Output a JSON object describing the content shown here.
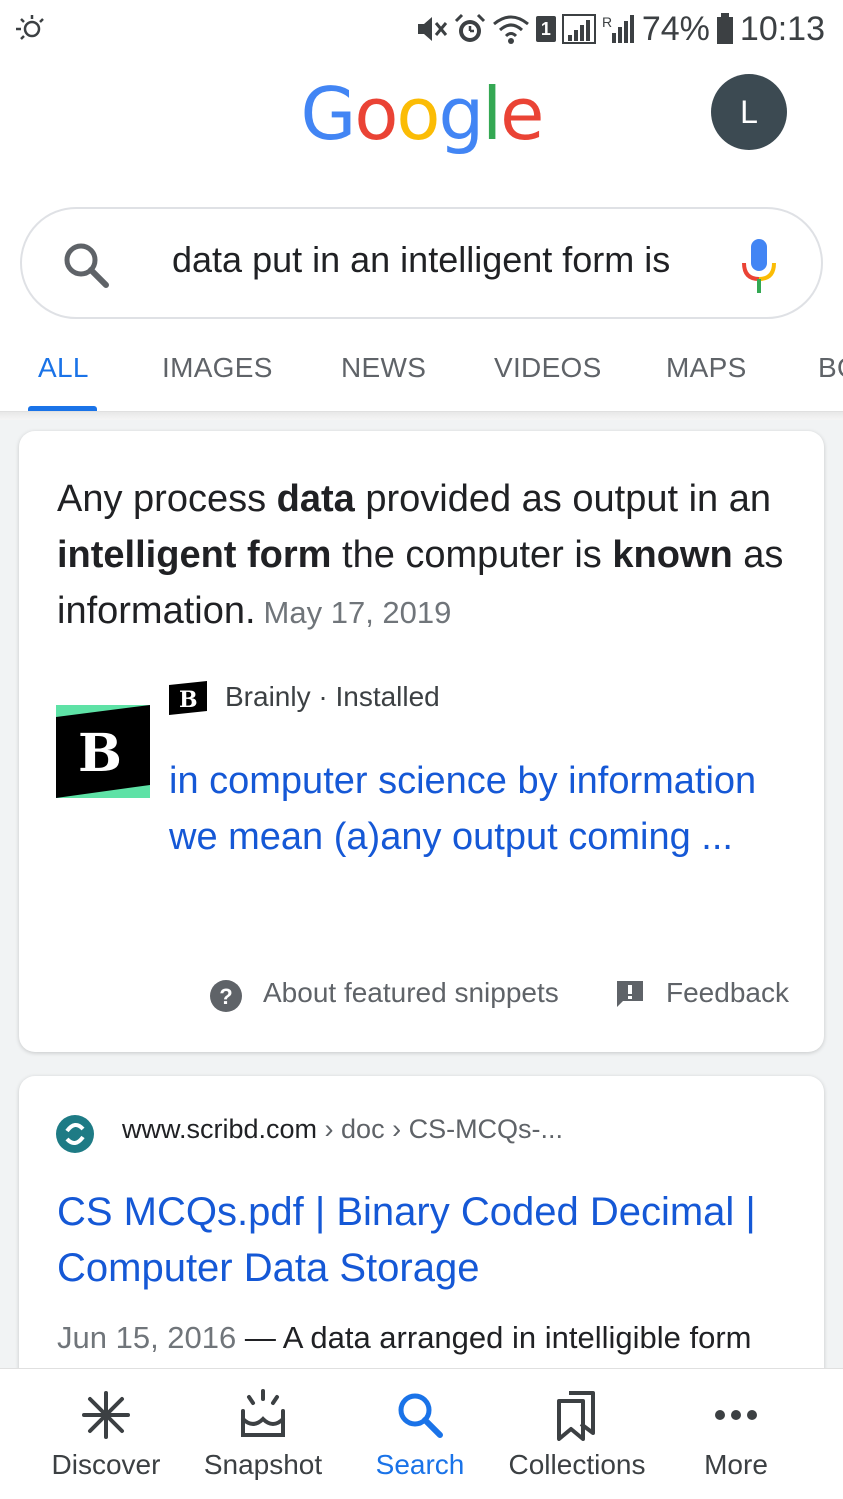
{
  "status_bar": {
    "battery": "74%",
    "time": "10:13",
    "sim_badge": "1"
  },
  "header": {
    "logo": [
      "G",
      "o",
      "o",
      "g",
      "l",
      "e"
    ],
    "logo_colors": [
      "#4285F4",
      "#EA4335",
      "#FBBC05",
      "#4285F4",
      "#34A853",
      "#EA4335"
    ],
    "avatar_initial": "L"
  },
  "search": {
    "query": "data put in an intelligent form is"
  },
  "tabs": [
    {
      "label": "ALL",
      "active": true
    },
    {
      "label": "IMAGES"
    },
    {
      "label": "NEWS"
    },
    {
      "label": "VIDEOS"
    },
    {
      "label": "MAPS"
    },
    {
      "label": "BOOKS"
    }
  ],
  "featured_snippet": {
    "text_parts": [
      {
        "t": "Any process ",
        "b": false
      },
      {
        "t": "data",
        "b": true
      },
      {
        "t": " provided as output in an ",
        "b": false
      },
      {
        "t": "intelligent form",
        "b": true
      },
      {
        "t": " the computer is ",
        "b": false
      },
      {
        "t": "known",
        "b": true
      },
      {
        "t": " as information.",
        "b": false
      }
    ],
    "date": "May 17, 2019",
    "source_name": "Brainly · Installed",
    "link_text": "in computer science by information we mean (a)any output coming ...",
    "about_label": "About featured snippets",
    "feedback_label": "Feedback"
  },
  "result": {
    "site": "www.scribd.com",
    "path": " › doc › CS-MCQs-...",
    "title": "CS MCQs.pdf | Binary Coded Decimal | Computer Data Storage",
    "date": "Jun 15, 2016",
    "snippet": " — A data arranged in intelligible form"
  },
  "bottom_nav": [
    {
      "label": "Discover",
      "icon": "discover-icon"
    },
    {
      "label": "Snapshot",
      "icon": "snapshot-icon"
    },
    {
      "label": "Search",
      "icon": "search-icon",
      "active": true
    },
    {
      "label": "Collections",
      "icon": "collections-icon"
    },
    {
      "label": "More",
      "icon": "more-icon"
    }
  ],
  "colors": {
    "accent": "#1a73e8",
    "link": "#1558d6",
    "brainly_green": "#5ee2a6"
  }
}
